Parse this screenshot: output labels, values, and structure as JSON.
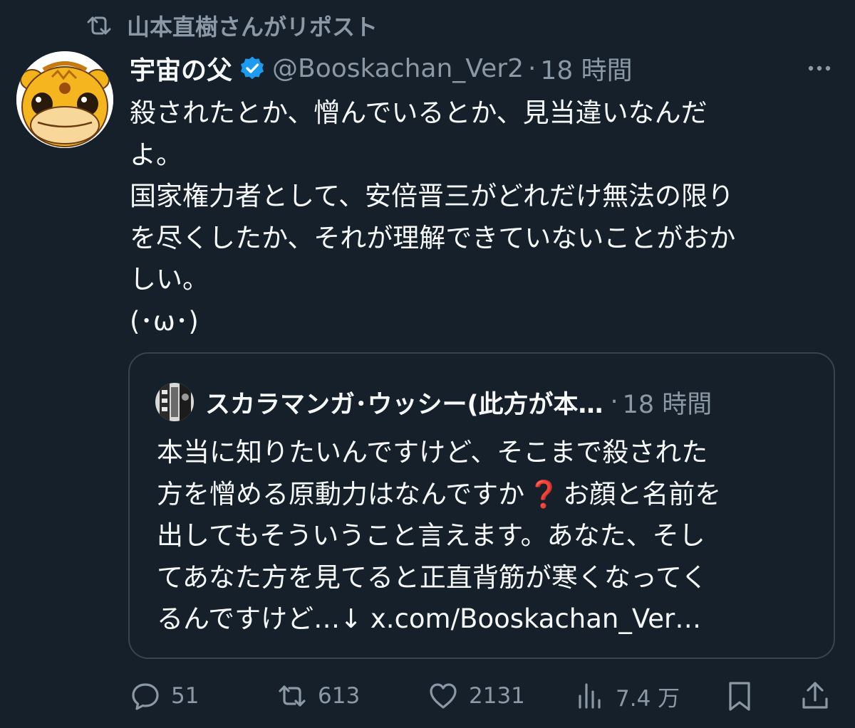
{
  "repost": {
    "label": "山本直樹さんがリポスト",
    "icon": "repost-icon"
  },
  "tweet": {
    "display_name": "宇宙の父",
    "verified": true,
    "handle": "@Booskachan_Ver2",
    "separator": "·",
    "time": "18 時間",
    "lines": [
      "殺されたとか、憎んでいるとか、見当違いなんだ",
      "よ。",
      "国家権力者として、安倍晋三がどれだけ無法の限り",
      "を尽くしたか、それが理解できていないことがおか",
      "しい。",
      "(･ω･)"
    ]
  },
  "quote": {
    "display_name": "スカラマンガ･ウッシー(此方が本…",
    "separator": "·",
    "time": "18 時間",
    "line1": "本当に知りたいんですけど、そこまで殺された",
    "line2_a": "方を憎める原動力はなんですか",
    "line2_mark": "❓",
    "line2_b": "お顔と名前を",
    "line3": "出してもそういうこと言えます。あなた、そし",
    "line4": "てあなた方を見てると正直背筋が寒くなってく",
    "line5": "るんですけど…↓ x.com/Booskachan_Ver…"
  },
  "actions": {
    "reply_count": "51",
    "repost_count": "613",
    "like_count": "2131",
    "views_count": "7.4 万"
  },
  "colors": {
    "background": "#15202b",
    "text": "#f7f9f9",
    "muted": "#8b98a5",
    "verified": "#1d9bf0",
    "border": "#38444d",
    "question_mark": "#e0245e"
  }
}
